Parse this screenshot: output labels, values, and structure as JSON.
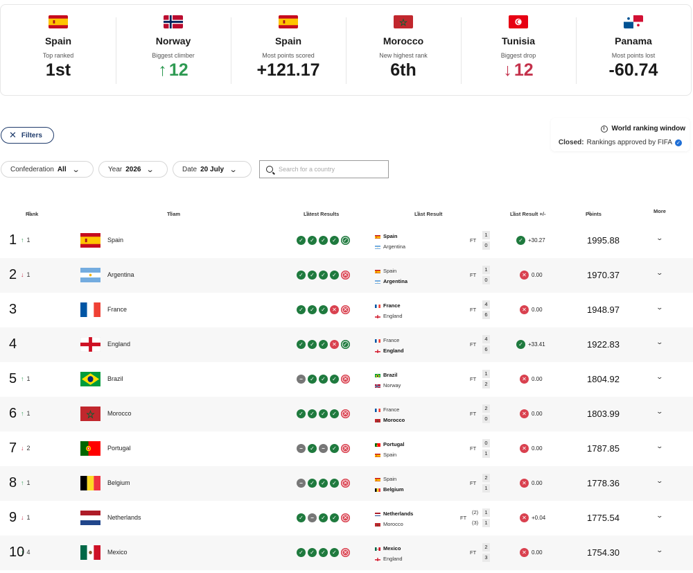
{
  "summary": [
    {
      "country": "Spain",
      "label": "Top ranked",
      "value": "1st",
      "flag": "spain",
      "arrow": ""
    },
    {
      "country": "Norway",
      "label": "Biggest climber",
      "value": "12",
      "flag": "norway",
      "arrow": "up"
    },
    {
      "country": "Spain",
      "label": "Most points scored",
      "value": "+121.17",
      "flag": "spain",
      "arrow": ""
    },
    {
      "country": "Morocco",
      "label": "New highest rank",
      "value": "6th",
      "flag": "morocco",
      "arrow": ""
    },
    {
      "country": "Tunisia",
      "label": "Biggest drop",
      "value": "12",
      "flag": "tunisia",
      "arrow": "down"
    },
    {
      "country": "Panama",
      "label": "Most points lost",
      "value": "-60.74",
      "flag": "panama",
      "arrow": ""
    }
  ],
  "filters": {
    "label": "Filters"
  },
  "ranking_window": {
    "title": "World ranking window",
    "status_label": "Closed:",
    "status_text": "Rankings approved by FIFA"
  },
  "dropdowns": {
    "confederation": {
      "label": "Confederation",
      "value": "All"
    },
    "year": {
      "label": "Year",
      "value": "2026"
    },
    "date": {
      "label": "Date",
      "value": "20 July"
    }
  },
  "search": {
    "placeholder": "Search for a country"
  },
  "columns": {
    "rank": "Rank",
    "team": "Team",
    "latest": "Latest Results",
    "last_result": "Last Result",
    "last_pm": "Last Result +/-",
    "points": "Points",
    "more": "More"
  },
  "rows": [
    {
      "rank": "1",
      "move_dir": "up",
      "move": "1",
      "team": "Spain",
      "flag": "spain",
      "results": [
        "w",
        "w",
        "w",
        "w",
        "lw"
      ],
      "home": {
        "name": "Spain",
        "flag": "spain",
        "score": "1",
        "win": true
      },
      "away": {
        "name": "Argentina",
        "flag": "argentina",
        "score": "0",
        "win": false
      },
      "ft": "FT",
      "pm_status": "w",
      "pm": "+30.27",
      "points": "1995.88"
    },
    {
      "rank": "2",
      "move_dir": "down",
      "move": "1",
      "team": "Argentina",
      "flag": "argentina",
      "results": [
        "w",
        "w",
        "w",
        "w",
        "ll"
      ],
      "home": {
        "name": "Spain",
        "flag": "spain",
        "score": "1",
        "win": false
      },
      "away": {
        "name": "Argentina",
        "flag": "argentina",
        "score": "0",
        "win": true
      },
      "ft": "FT",
      "pm_status": "l",
      "pm": "0.00",
      "points": "1970.37"
    },
    {
      "rank": "3",
      "move_dir": "",
      "move": "",
      "team": "France",
      "flag": "france",
      "results": [
        "w",
        "w",
        "w",
        "l",
        "ll"
      ],
      "home": {
        "name": "France",
        "flag": "france",
        "score": "4",
        "win": true
      },
      "away": {
        "name": "England",
        "flag": "england",
        "score": "6",
        "win": false
      },
      "ft": "FT",
      "pm_status": "l",
      "pm": "0.00",
      "points": "1948.97"
    },
    {
      "rank": "4",
      "move_dir": "",
      "move": "",
      "team": "England",
      "flag": "england",
      "results": [
        "w",
        "w",
        "w",
        "l",
        "lw"
      ],
      "home": {
        "name": "France",
        "flag": "france",
        "score": "4",
        "win": false
      },
      "away": {
        "name": "England",
        "flag": "england",
        "score": "6",
        "win": true
      },
      "ft": "FT",
      "pm_status": "w",
      "pm": "+33.41",
      "points": "1922.83"
    },
    {
      "rank": "5",
      "move_dir": "up",
      "move": "1",
      "team": "Brazil",
      "flag": "brazil",
      "results": [
        "d",
        "w",
        "w",
        "w",
        "ll"
      ],
      "home": {
        "name": "Brazil",
        "flag": "brazil",
        "score": "1",
        "win": true
      },
      "away": {
        "name": "Norway",
        "flag": "norway",
        "score": "2",
        "win": false
      },
      "ft": "FT",
      "pm_status": "l",
      "pm": "0.00",
      "points": "1804.92"
    },
    {
      "rank": "6",
      "move_dir": "up",
      "move": "1",
      "team": "Morocco",
      "flag": "morocco",
      "results": [
        "w",
        "w",
        "w",
        "w",
        "ll"
      ],
      "home": {
        "name": "France",
        "flag": "france",
        "score": "2",
        "win": false
      },
      "away": {
        "name": "Morocco",
        "flag": "morocco",
        "score": "0",
        "win": true
      },
      "ft": "FT",
      "pm_status": "l",
      "pm": "0.00",
      "points": "1803.99"
    },
    {
      "rank": "7",
      "move_dir": "down",
      "move": "2",
      "team": "Portugal",
      "flag": "portugal",
      "results": [
        "d",
        "w",
        "d",
        "w",
        "ll"
      ],
      "home": {
        "name": "Portugal",
        "flag": "portugal",
        "score": "0",
        "win": true
      },
      "away": {
        "name": "Spain",
        "flag": "spain",
        "score": "1",
        "win": false
      },
      "ft": "FT",
      "pm_status": "l",
      "pm": "0.00",
      "points": "1787.85"
    },
    {
      "rank": "8",
      "move_dir": "up",
      "move": "1",
      "team": "Belgium",
      "flag": "belgium",
      "results": [
        "d",
        "w",
        "w",
        "w",
        "ll"
      ],
      "home": {
        "name": "Spain",
        "flag": "spain",
        "score": "2",
        "win": false
      },
      "away": {
        "name": "Belgium",
        "flag": "belgium",
        "score": "1",
        "win": true
      },
      "ft": "FT",
      "pm_status": "l",
      "pm": "0.00",
      "points": "1778.36"
    },
    {
      "rank": "9",
      "move_dir": "down",
      "move": "1",
      "team": "Netherlands",
      "flag": "netherlands",
      "results": [
        "w",
        "d",
        "w",
        "w",
        "ll"
      ],
      "home": {
        "name": "Netherlands",
        "flag": "netherlands",
        "score": "1",
        "win": true,
        "pens": "(2)"
      },
      "away": {
        "name": "Morocco",
        "flag": "morocco",
        "score": "1",
        "win": false,
        "pens": "(3)"
      },
      "ft": "FT",
      "pm_status": "l",
      "pm": "+0.04",
      "points": "1775.54"
    },
    {
      "rank": "10",
      "move_dir": "up",
      "move": "4",
      "team": "Mexico",
      "flag": "mexico",
      "results": [
        "w",
        "w",
        "w",
        "w",
        "ll"
      ],
      "home": {
        "name": "Mexico",
        "flag": "mexico",
        "score": "2",
        "win": true
      },
      "away": {
        "name": "England",
        "flag": "england",
        "score": "3",
        "win": false
      },
      "ft": "FT",
      "pm_status": "l",
      "pm": "0.00",
      "points": "1754.30"
    }
  ],
  "colors": {
    "win": "#1f7a3e",
    "loss": "#d9414f",
    "draw": "#777777",
    "up": "#2e9a52",
    "down": "#c4314b",
    "accent": "#1f3b6b"
  }
}
